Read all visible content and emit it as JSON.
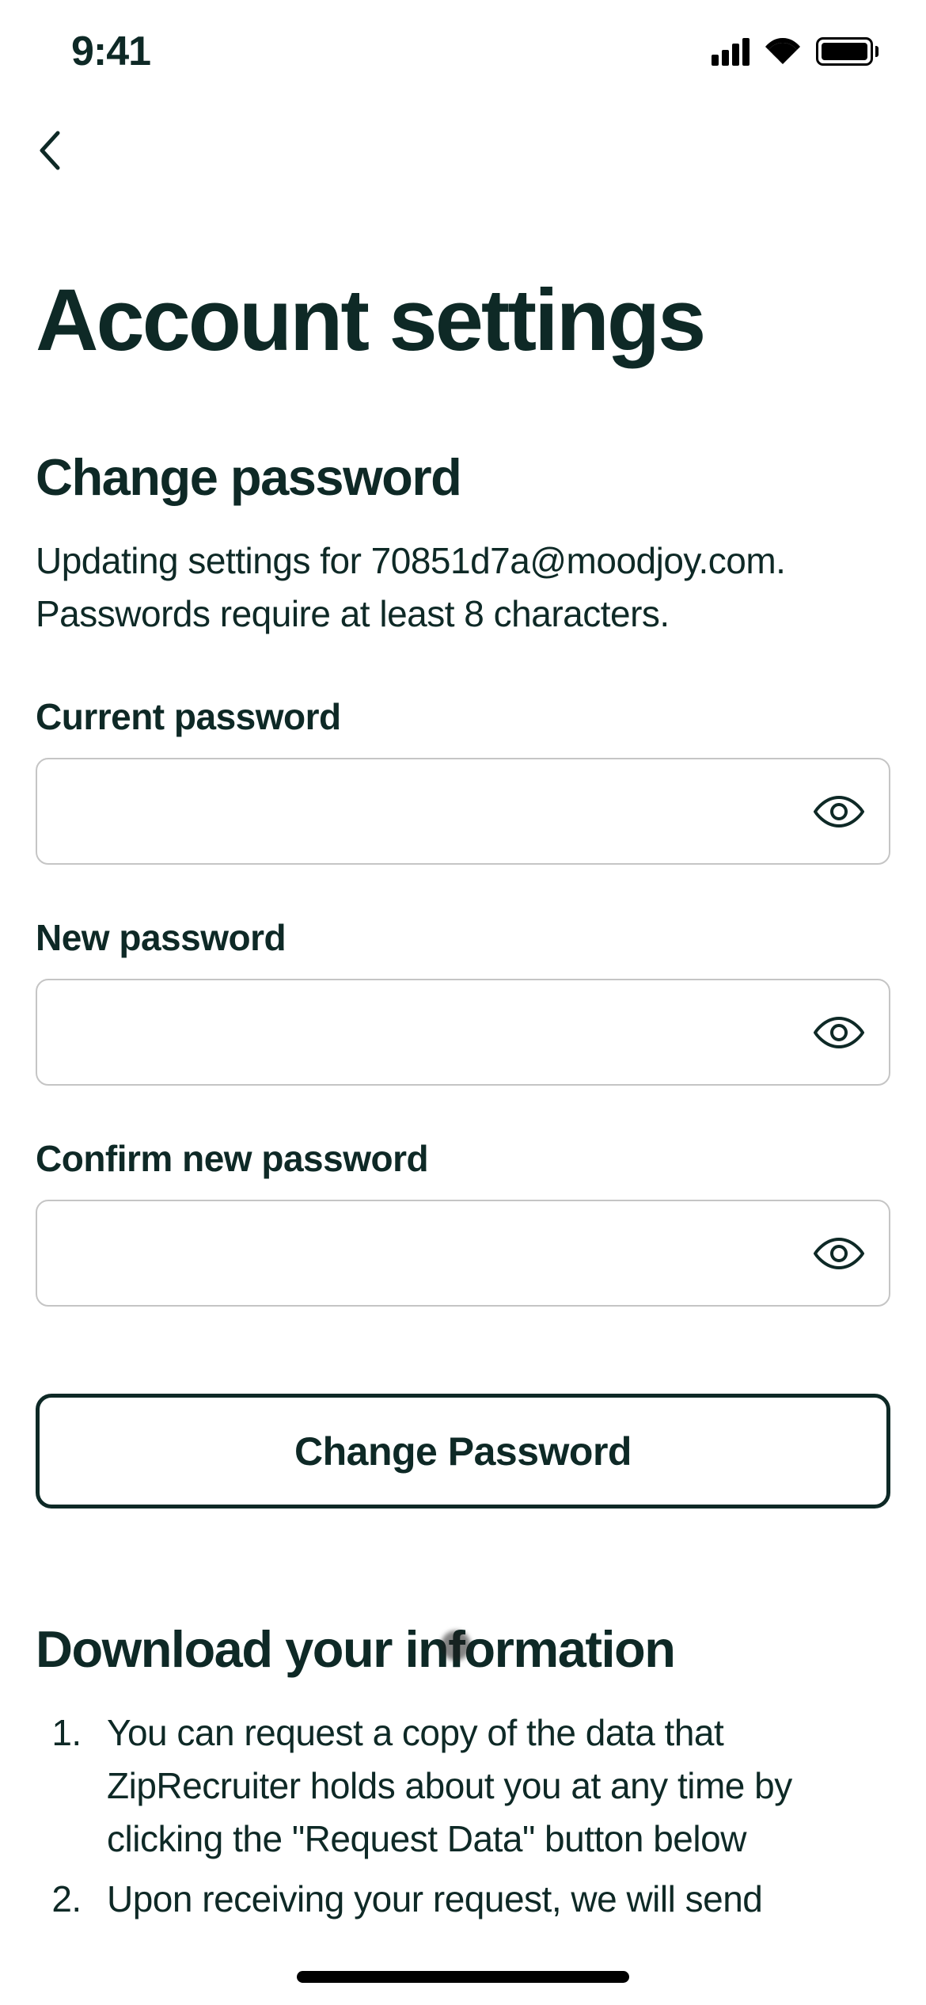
{
  "statusBar": {
    "time": "9:41"
  },
  "page": {
    "title": "Account settings"
  },
  "changePassword": {
    "title": "Change password",
    "description": "Updating settings for 70851d7a@moodjoy.com. Passwords require at least 8 characters.",
    "fields": {
      "current": {
        "label": "Current password",
        "value": ""
      },
      "new": {
        "label": "New password",
        "value": ""
      },
      "confirm": {
        "label": "Confirm new password",
        "value": ""
      }
    },
    "submitLabel": "Change Password"
  },
  "download": {
    "title": "Download your information",
    "items": [
      "You can request a copy of the data that ZipRecruiter holds about you at any time by clicking the \"Request Data\" button below",
      "Upon receiving your request, we will send"
    ]
  }
}
